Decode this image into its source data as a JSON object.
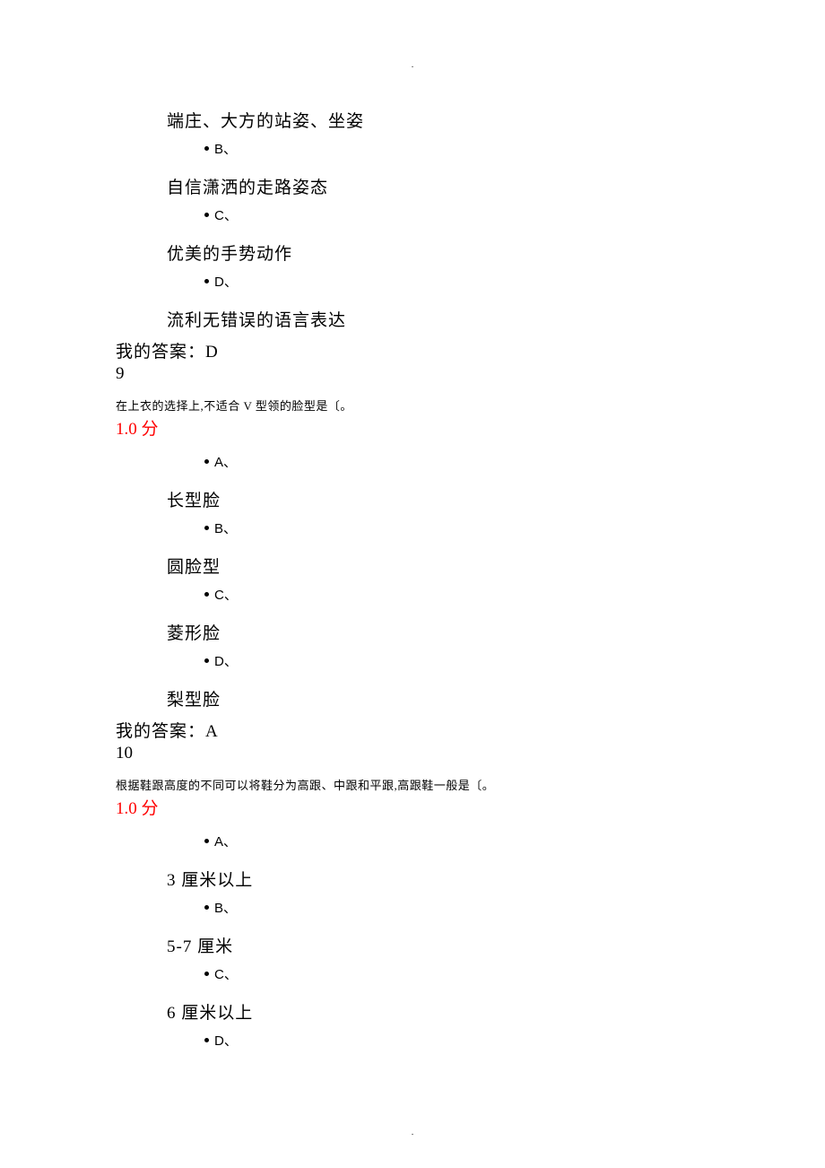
{
  "dot_top": ".",
  "dot_bottom": ".",
  "q8": {
    "opt_a_text": "端庄、大方的站姿、坐姿",
    "bullet_b": "B、",
    "opt_b_text": "自信潇洒的走路姿态",
    "bullet_c": "C、",
    "opt_c_text": "优美的手势动作",
    "bullet_d": "D、",
    "opt_d_text": "流利无错误的语言表达",
    "my_answer": "我的答案：D"
  },
  "q9": {
    "number": "9",
    "question": "在上衣的选择上,不适合 V 型领的脸型是〔。",
    "score": "1.0  分",
    "bullet_a": "A、",
    "opt_a_text": "长型脸",
    "bullet_b": "B、",
    "opt_b_text": "圆脸型",
    "bullet_c": "C、",
    "opt_c_text": "菱形脸",
    "bullet_d": "D、",
    "opt_d_text": "梨型脸",
    "my_answer": "我的答案：A"
  },
  "q10": {
    "number": "10",
    "question": "根据鞋跟高度的不同可以将鞋分为高跟、中跟和平跟,高跟鞋一般是〔。",
    "score": "1.0  分",
    "bullet_a": "A、",
    "opt_a_text": "3 厘米以上",
    "bullet_b": "B、",
    "opt_b_text": "5-7 厘米",
    "bullet_c": "C、",
    "opt_c_text": "6 厘米以上",
    "bullet_d": "D、"
  }
}
